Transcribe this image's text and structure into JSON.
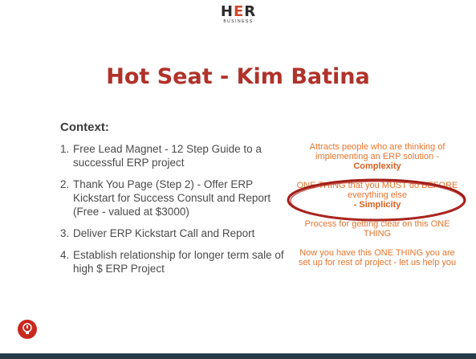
{
  "logo": {
    "main_left": "H",
    "main_mid": "E",
    "main_right": "R",
    "sub": "BUSINESS"
  },
  "title": "Hot Seat - Kim Batina",
  "context_heading": "Context:",
  "items": [
    {
      "num": "1.",
      "text": "Free Lead Magnet - 12 Step Guide to a successful ERP project"
    },
    {
      "num": "2.",
      "text": "Thank You Page (Step 2) - Offer ERP Kickstart for Success Consult and Report (Free - valued at $3000)"
    },
    {
      "num": "3.",
      "text": "Deliver ERP Kickstart Call and Report"
    },
    {
      "num": "4.",
      "text": "Establish relationship for longer term sale of high $ ERP Project"
    }
  ],
  "notes": {
    "n1": "Attracts people who are thinking of implementing an ERP solution -",
    "n1_bold": "Complexity",
    "n2": "ONE THING that you MUST do BEFORE everything else",
    "n2_bold": "- Simplicity",
    "n3": "Process for getting clear on this ONE THING",
    "n4": "Now you have this ONE THING you are set up for rest of project - let us help you"
  },
  "colors": {
    "title": "#b0322a",
    "note": "#e8742c",
    "ellipse": "#a01f1a",
    "footer": "#263a47"
  },
  "icons": {
    "bulb": "lightbulb-icon"
  }
}
